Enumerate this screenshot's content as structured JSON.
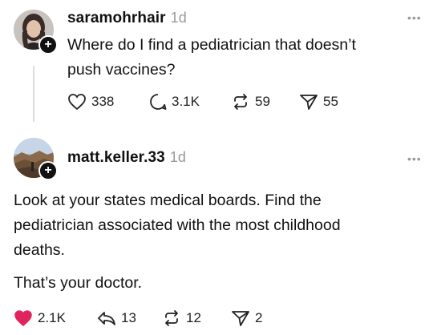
{
  "post": {
    "username": "saramohrhair",
    "time": "1d",
    "text_line1": "Where do I find a pediatrician that doesn’t",
    "text_line2": "push vaccines?",
    "stats": {
      "likes": "338",
      "comments": "3.1K",
      "reposts": "59",
      "shares": "55"
    },
    "more_icon": "ellipsis-icon"
  },
  "reply": {
    "username": "matt.keller.33",
    "time": "1d",
    "line1": "Look at your states medical boards.  Find the",
    "line2": "pediatrician associated with the most childhood",
    "line3": "deaths.",
    "line4": "That’s your doctor.",
    "stats": {
      "likes": "2.1K",
      "comments": "13",
      "reposts": "12",
      "shares": "2"
    },
    "like_color": "#e0245e"
  },
  "icons": {
    "plus": "+",
    "more": "•••"
  }
}
